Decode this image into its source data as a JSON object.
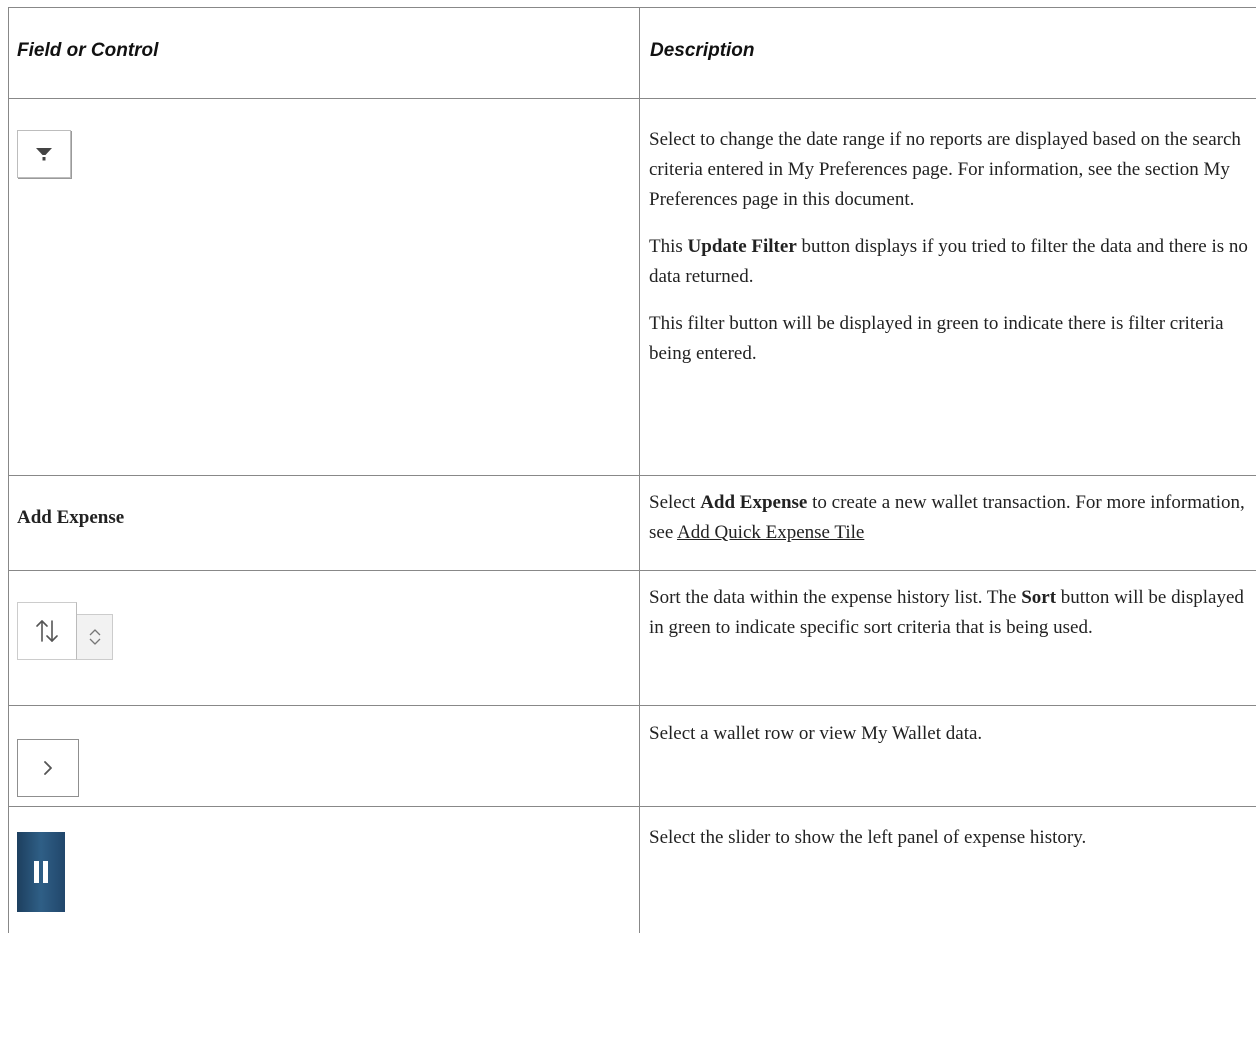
{
  "header": {
    "col_field": "Field or Control",
    "col_description": "Description"
  },
  "rows": [
    {
      "field_icon": "filter-icon",
      "desc": [
        "Select to change the date range if no reports are displayed based on the search criteria entered in My Preferences page.  For information, see the section My Preferences page in this document.",
        {
          "pre": "This ",
          "bold": "Update Filter",
          "post": " button displays if you tried to filter the data and there is no data returned."
        },
        "This filter button will be displayed in green to indicate there is filter criteria being entered."
      ]
    },
    {
      "field_label": "Add Expense",
      "desc": {
        "pre": "Select ",
        "bold": "Add Expense",
        "post": " to create a new wallet transaction. For more information, see ",
        "link": "Add Quick Expense Tile"
      }
    },
    {
      "field_icon": "sort-icon",
      "desc": {
        "pre": "Sort the data within the expense history list. The ",
        "bold": "Sort",
        "post": " button will be displayed in green to indicate specific sort criteria that is being used."
      }
    },
    {
      "field_icon": "chevron-right-icon",
      "desc": "Select a wallet row or view My Wallet data."
    },
    {
      "field_icon": "slider-pause-icon",
      "desc": "Select the slider to show the left panel of expense history."
    }
  ],
  "colors": {
    "border": "#888888",
    "slider_dark": "#1d3f5f",
    "slider_light": "#2f5f86"
  }
}
